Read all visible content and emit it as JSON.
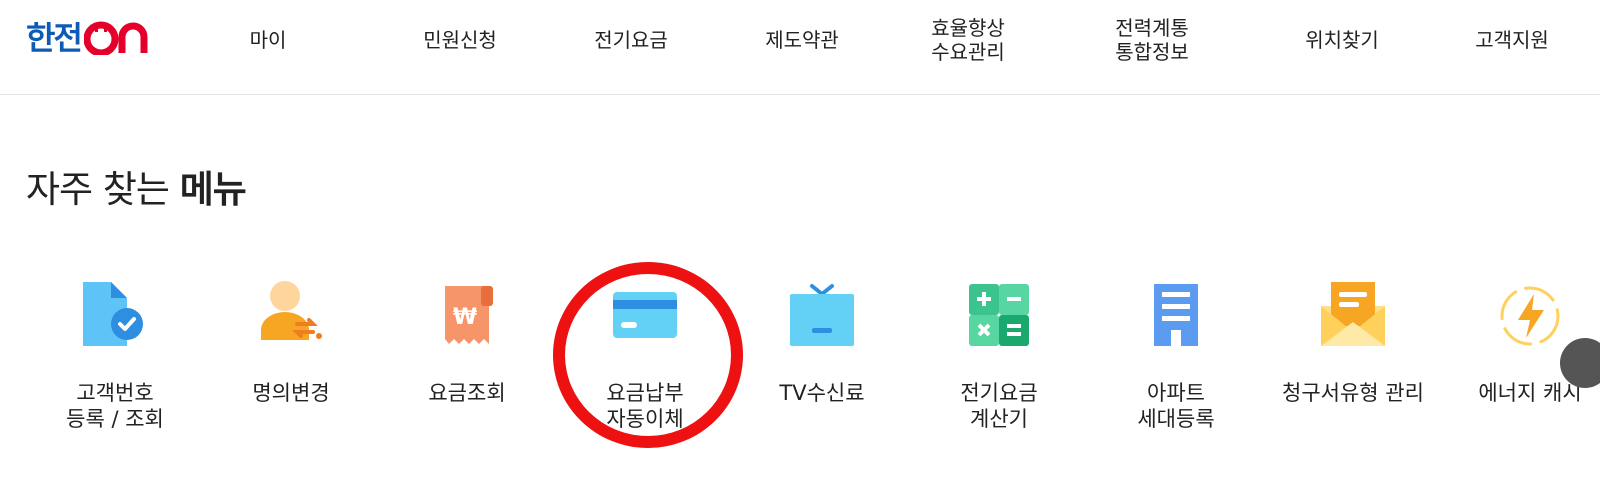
{
  "header": {
    "logo_text": "한전",
    "logo_on": "on",
    "nav": [
      {
        "lines": [
          "마이"
        ]
      },
      {
        "lines": [
          "민원신청"
        ]
      },
      {
        "lines": [
          "전기요금"
        ]
      },
      {
        "lines": [
          "제도약관"
        ]
      },
      {
        "lines": [
          "효율향상",
          "수요관리"
        ]
      },
      {
        "lines": [
          "전력계통",
          "통합정보"
        ]
      },
      {
        "lines": [
          "위치찾기"
        ]
      },
      {
        "lines": [
          "고객지원"
        ]
      }
    ]
  },
  "section": {
    "title_normal": "자주 찾는 ",
    "title_bold": "메뉴"
  },
  "quick_menu": [
    {
      "icon": "document-check-icon",
      "lines": [
        "고객번호",
        "등록 / 조회"
      ]
    },
    {
      "icon": "person-transfer-icon",
      "lines": [
        "명의변경"
      ]
    },
    {
      "icon": "won-receipt-icon",
      "lines": [
        "요금조회"
      ]
    },
    {
      "icon": "credit-card-icon",
      "lines": [
        "요금납부",
        "자동이체"
      ]
    },
    {
      "icon": "tv-icon",
      "lines": [
        "TV수신료"
      ]
    },
    {
      "icon": "calculator-icon",
      "lines": [
        "전기요금",
        "계산기"
      ]
    },
    {
      "icon": "apartment-icon",
      "lines": [
        "아파트",
        "세대등록"
      ]
    },
    {
      "icon": "mail-envelope-icon",
      "lines": [
        "청구서유형 관리"
      ]
    },
    {
      "icon": "energy-lightning-icon",
      "lines": [
        "에너지 캐시"
      ]
    }
  ],
  "colors": {
    "brand_blue": "#0e5bb5",
    "brand_red": "#e4002b",
    "highlight_red": "#ee1111"
  }
}
